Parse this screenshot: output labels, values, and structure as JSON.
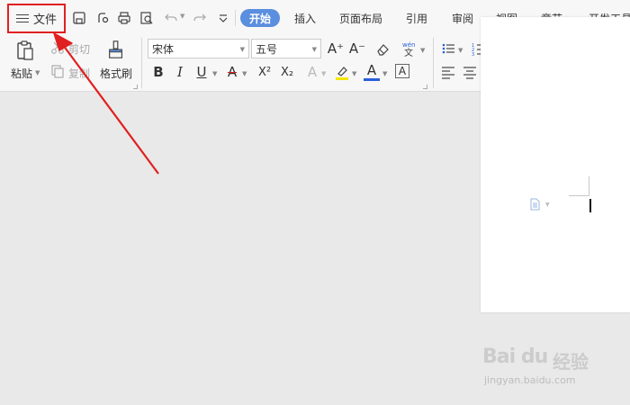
{
  "menu": {
    "file_label": "文件",
    "tabs": [
      {
        "label": "开始",
        "active": true
      },
      {
        "label": "插入",
        "active": false
      },
      {
        "label": "页面布局",
        "active": false
      },
      {
        "label": "引用",
        "active": false
      },
      {
        "label": "审阅",
        "active": false
      },
      {
        "label": "视图",
        "active": false
      },
      {
        "label": "章节",
        "active": false
      },
      {
        "label": "开发工具",
        "active": false
      }
    ]
  },
  "clipboard": {
    "paste": "粘贴",
    "cut": "剪切",
    "copy": "复制",
    "format_painter": "格式刷"
  },
  "font": {
    "family": "宋体",
    "size": "五号",
    "bold": "B",
    "italic": "I",
    "underline": "U",
    "strike": "A",
    "superscript": "X²",
    "subscript": "X₂",
    "text_effect": "A",
    "font_color": "A",
    "char_border": "A",
    "grow": "A⁺",
    "shrink": "A⁻"
  },
  "colors": {
    "accent": "#5a8ede",
    "highlight": "#f5e600",
    "font_color": "#2b5fd9",
    "annotation": "#e02020"
  },
  "watermark": {
    "logo": "Bai du",
    "brand_cn": "经验",
    "url": "jingyan.baidu.com"
  }
}
